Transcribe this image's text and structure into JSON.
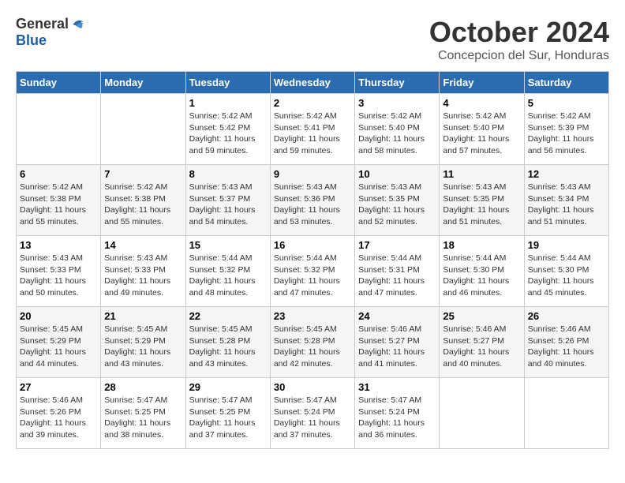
{
  "logo": {
    "general": "General",
    "blue": "Blue"
  },
  "title": "October 2024",
  "location": "Concepcion del Sur, Honduras",
  "days_of_week": [
    "Sunday",
    "Monday",
    "Tuesday",
    "Wednesday",
    "Thursday",
    "Friday",
    "Saturday"
  ],
  "weeks": [
    [
      {
        "day": "",
        "info": ""
      },
      {
        "day": "",
        "info": ""
      },
      {
        "day": "1",
        "info": "Sunrise: 5:42 AM\nSunset: 5:42 PM\nDaylight: 11 hours and 59 minutes."
      },
      {
        "day": "2",
        "info": "Sunrise: 5:42 AM\nSunset: 5:41 PM\nDaylight: 11 hours and 59 minutes."
      },
      {
        "day": "3",
        "info": "Sunrise: 5:42 AM\nSunset: 5:40 PM\nDaylight: 11 hours and 58 minutes."
      },
      {
        "day": "4",
        "info": "Sunrise: 5:42 AM\nSunset: 5:40 PM\nDaylight: 11 hours and 57 minutes."
      },
      {
        "day": "5",
        "info": "Sunrise: 5:42 AM\nSunset: 5:39 PM\nDaylight: 11 hours and 56 minutes."
      }
    ],
    [
      {
        "day": "6",
        "info": "Sunrise: 5:42 AM\nSunset: 5:38 PM\nDaylight: 11 hours and 55 minutes."
      },
      {
        "day": "7",
        "info": "Sunrise: 5:42 AM\nSunset: 5:38 PM\nDaylight: 11 hours and 55 minutes."
      },
      {
        "day": "8",
        "info": "Sunrise: 5:43 AM\nSunset: 5:37 PM\nDaylight: 11 hours and 54 minutes."
      },
      {
        "day": "9",
        "info": "Sunrise: 5:43 AM\nSunset: 5:36 PM\nDaylight: 11 hours and 53 minutes."
      },
      {
        "day": "10",
        "info": "Sunrise: 5:43 AM\nSunset: 5:35 PM\nDaylight: 11 hours and 52 minutes."
      },
      {
        "day": "11",
        "info": "Sunrise: 5:43 AM\nSunset: 5:35 PM\nDaylight: 11 hours and 51 minutes."
      },
      {
        "day": "12",
        "info": "Sunrise: 5:43 AM\nSunset: 5:34 PM\nDaylight: 11 hours and 51 minutes."
      }
    ],
    [
      {
        "day": "13",
        "info": "Sunrise: 5:43 AM\nSunset: 5:33 PM\nDaylight: 11 hours and 50 minutes."
      },
      {
        "day": "14",
        "info": "Sunrise: 5:43 AM\nSunset: 5:33 PM\nDaylight: 11 hours and 49 minutes."
      },
      {
        "day": "15",
        "info": "Sunrise: 5:44 AM\nSunset: 5:32 PM\nDaylight: 11 hours and 48 minutes."
      },
      {
        "day": "16",
        "info": "Sunrise: 5:44 AM\nSunset: 5:32 PM\nDaylight: 11 hours and 47 minutes."
      },
      {
        "day": "17",
        "info": "Sunrise: 5:44 AM\nSunset: 5:31 PM\nDaylight: 11 hours and 47 minutes."
      },
      {
        "day": "18",
        "info": "Sunrise: 5:44 AM\nSunset: 5:30 PM\nDaylight: 11 hours and 46 minutes."
      },
      {
        "day": "19",
        "info": "Sunrise: 5:44 AM\nSunset: 5:30 PM\nDaylight: 11 hours and 45 minutes."
      }
    ],
    [
      {
        "day": "20",
        "info": "Sunrise: 5:45 AM\nSunset: 5:29 PM\nDaylight: 11 hours and 44 minutes."
      },
      {
        "day": "21",
        "info": "Sunrise: 5:45 AM\nSunset: 5:29 PM\nDaylight: 11 hours and 43 minutes."
      },
      {
        "day": "22",
        "info": "Sunrise: 5:45 AM\nSunset: 5:28 PM\nDaylight: 11 hours and 43 minutes."
      },
      {
        "day": "23",
        "info": "Sunrise: 5:45 AM\nSunset: 5:28 PM\nDaylight: 11 hours and 42 minutes."
      },
      {
        "day": "24",
        "info": "Sunrise: 5:46 AM\nSunset: 5:27 PM\nDaylight: 11 hours and 41 minutes."
      },
      {
        "day": "25",
        "info": "Sunrise: 5:46 AM\nSunset: 5:27 PM\nDaylight: 11 hours and 40 minutes."
      },
      {
        "day": "26",
        "info": "Sunrise: 5:46 AM\nSunset: 5:26 PM\nDaylight: 11 hours and 40 minutes."
      }
    ],
    [
      {
        "day": "27",
        "info": "Sunrise: 5:46 AM\nSunset: 5:26 PM\nDaylight: 11 hours and 39 minutes."
      },
      {
        "day": "28",
        "info": "Sunrise: 5:47 AM\nSunset: 5:25 PM\nDaylight: 11 hours and 38 minutes."
      },
      {
        "day": "29",
        "info": "Sunrise: 5:47 AM\nSunset: 5:25 PM\nDaylight: 11 hours and 37 minutes."
      },
      {
        "day": "30",
        "info": "Sunrise: 5:47 AM\nSunset: 5:24 PM\nDaylight: 11 hours and 37 minutes."
      },
      {
        "day": "31",
        "info": "Sunrise: 5:47 AM\nSunset: 5:24 PM\nDaylight: 11 hours and 36 minutes."
      },
      {
        "day": "",
        "info": ""
      },
      {
        "day": "",
        "info": ""
      }
    ]
  ]
}
